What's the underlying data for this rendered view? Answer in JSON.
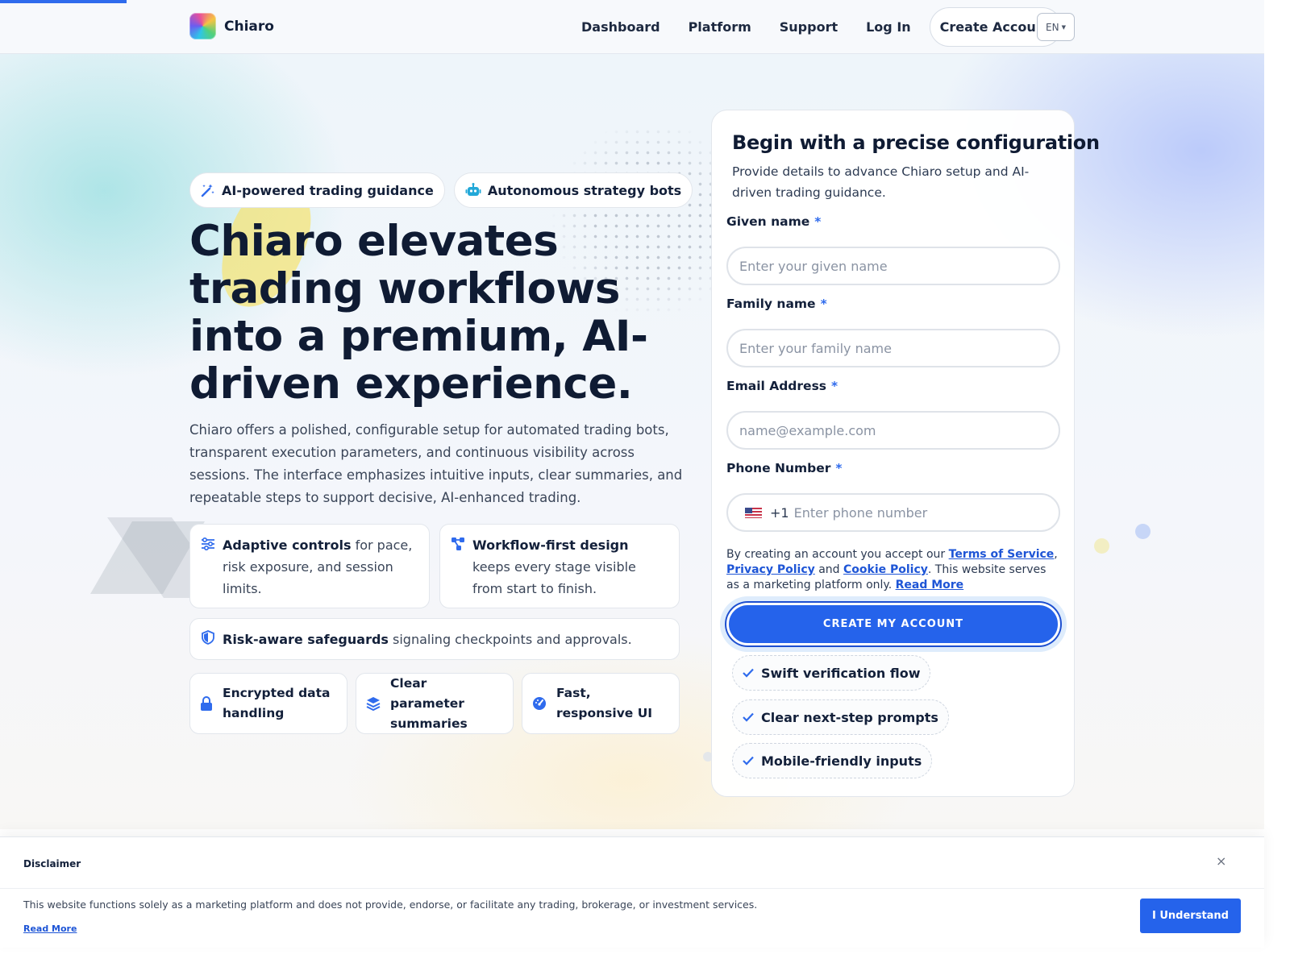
{
  "header": {
    "brand": "Chiaro",
    "nav": [
      "Dashboard",
      "Platform",
      "Support",
      "Log In"
    ],
    "cta": "Create Account",
    "language": "EN"
  },
  "hero": {
    "chips": [
      "AI-powered trading guidance",
      "Autonomous strategy bots"
    ],
    "title": "Chiaro elevates trading workflows into a premium, AI-driven experience.",
    "description": "Chiaro offers a polished, configurable setup for automated trading bots, transparent execution parameters, and continuous visibility across sessions. The interface emphasizes intuitive inputs, clear summaries, and repeatable steps to support decisive, AI-enhanced trading.",
    "features": [
      {
        "bold": "Adaptive controls",
        "rest": " for pace, risk exposure, and session limits."
      },
      {
        "bold": "Workflow-first design",
        "rest": " keeps every stage visible from start to finish."
      },
      {
        "bold": "Risk-aware safeguards",
        "rest": " signaling checkpoints and approvals."
      }
    ],
    "mini_features": [
      "Encrypted data handling",
      "Clear parameter summaries",
      "Fast, responsive UI"
    ]
  },
  "form": {
    "title": "Begin with a precise configuration",
    "subtitle": "Provide details to advance Chiaro setup and AI-driven trading guidance.",
    "given_name": {
      "label": "Given name",
      "placeholder": "Enter your given name"
    },
    "family_name": {
      "label": "Family name",
      "placeholder": "Enter your family name"
    },
    "email": {
      "label": "Email Address",
      "placeholder": "name@example.com"
    },
    "phone": {
      "label": "Phone Number",
      "dial_code": "+1",
      "placeholder": "Enter phone number"
    },
    "required_mark": "*",
    "terms": {
      "prefix": "By creating an account you accept our ",
      "tos": "Terms of Service",
      "comma": ",",
      "privacy": "Privacy Policy",
      "and": " and ",
      "cookie": "Cookie Policy",
      "suffix": ". This website serves as a marketing platform only. ",
      "read_more": "Read More"
    },
    "submit": "CREATE MY ACCOUNT",
    "benefits": [
      "Swift verification flow",
      "Clear next-step prompts",
      "Mobile-friendly inputs"
    ]
  },
  "disclaimer": {
    "title": "Disclaimer",
    "close": "×",
    "text": "This website functions solely as a marketing platform and does not provide, endorse, or facilitate any trading, brokerage, or investment services.",
    "read_more": "Read More",
    "button": "I Understand"
  },
  "colors": {
    "accent": "#2563eb",
    "text": "#0f1b33",
    "required": "#2f6bed"
  }
}
